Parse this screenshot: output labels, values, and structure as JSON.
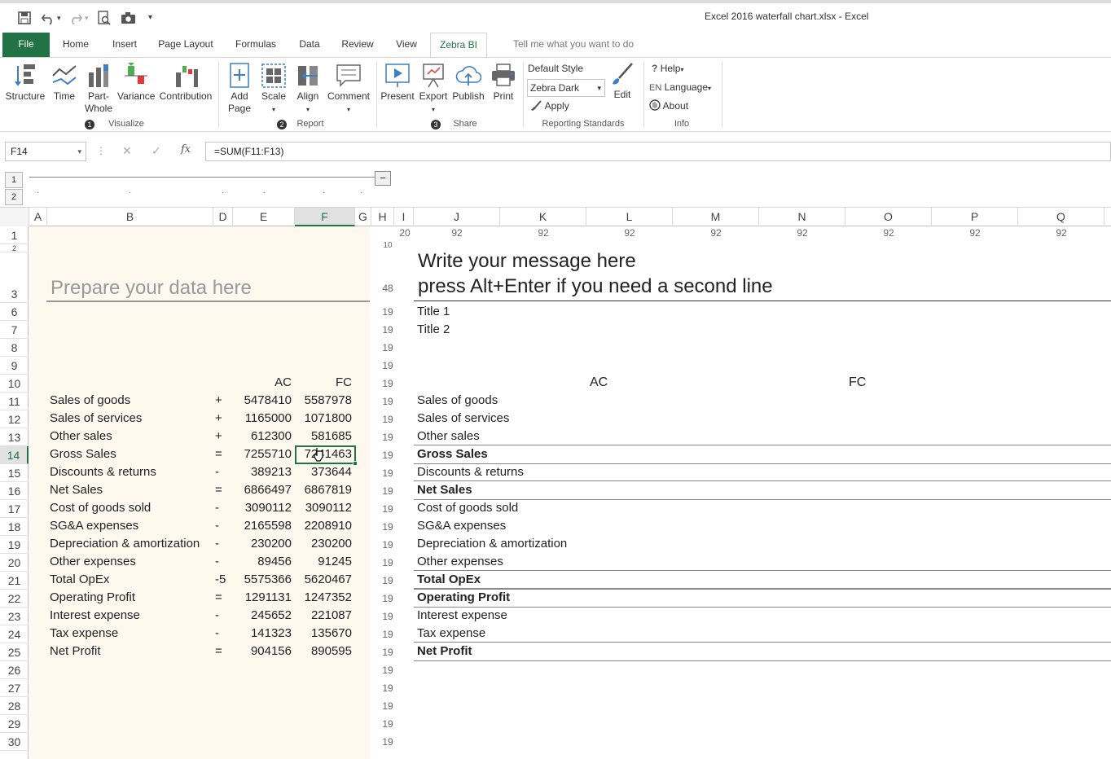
{
  "window": {
    "title": "Excel 2016 waterfall chart.xlsx - Excel"
  },
  "qat": {
    "save_icon": "save-icon",
    "undo_icon": "undo-icon",
    "redo_icon": "redo-icon",
    "preview_icon": "print-preview-icon",
    "camera_icon": "camera-icon"
  },
  "tabs": [
    "File",
    "Home",
    "Insert",
    "Page Layout",
    "Formulas",
    "Data",
    "Review",
    "View",
    "Zebra BI"
  ],
  "tell_me": "Tell me what you want to do",
  "ribbon": {
    "visualize": {
      "structure": "Structure",
      "time": "Time",
      "part_whole": "Part-\nWhole",
      "part": "Part-",
      "whole": "Whole",
      "variance": "Variance",
      "contribution": "Contribution",
      "label": "Visualize",
      "num": "1"
    },
    "report": {
      "add": "Add",
      "page": "Page",
      "scale": "Scale",
      "align": "Align",
      "comment": "Comment",
      "label": "Report",
      "num": "2"
    },
    "share": {
      "present": "Present",
      "export": "Export",
      "publish": "Publish",
      "print": "Print",
      "label": "Share",
      "num": "3"
    },
    "standards": {
      "default_style": "Default Style",
      "style_value": "Zebra Dark",
      "apply": "Apply",
      "edit": "Edit",
      "label": "Reporting Standards"
    },
    "info": {
      "help": "Help",
      "lang_code": "EN",
      "language": "Language",
      "about": "About",
      "label": "Info"
    }
  },
  "formula_bar": {
    "name_box": "F14",
    "fx": "fx",
    "formula": "=SUM(F11:F13)"
  },
  "outline": {
    "level1": "1",
    "level2": "2",
    "collapse": "−"
  },
  "columns": [
    "A",
    "B",
    "D",
    "E",
    "F",
    "G",
    "H",
    "I",
    "J",
    "K",
    "L",
    "M",
    "N",
    "O",
    "P",
    "Q"
  ],
  "col_widths": {
    "i": "20",
    "j": "92",
    "k": "92",
    "l": "92",
    "m": "92",
    "n": "92",
    "o": "92",
    "p": "92",
    "q": "92"
  },
  "rows": [
    "1",
    "2",
    "3",
    "6",
    "7",
    "8",
    "9",
    "10",
    "11",
    "12",
    "13",
    "14",
    "15",
    "16",
    "17",
    "18",
    "19",
    "20",
    "21",
    "22",
    "23",
    "24",
    "25",
    "26",
    "27",
    "28",
    "29",
    "30"
  ],
  "row_height_labels": {
    "r1": "10",
    "r3": "48",
    "std": "19"
  },
  "left": {
    "heading": "Prepare your data here",
    "col_ac": "AC",
    "col_fc": "FC",
    "items": [
      {
        "label": "Sales of goods",
        "op": "+",
        "ac": "5478410",
        "fc": "5587978"
      },
      {
        "label": "Sales of services",
        "op": "+",
        "ac": "1165000",
        "fc": "1071800"
      },
      {
        "label": "Other sales",
        "op": "+",
        "ac": "612300",
        "fc": "581685"
      },
      {
        "label": "Gross Sales",
        "op": "=",
        "ac": "7255710",
        "fc": "7241463"
      },
      {
        "label": "Discounts & returns",
        "op": "-",
        "ac": "389213",
        "fc": "373644"
      },
      {
        "label": "Net Sales",
        "op": "=",
        "ac": "6866497",
        "fc": "6867819"
      },
      {
        "label": "Cost of goods sold",
        "op": "-",
        "ac": "3090112",
        "fc": "3090112"
      },
      {
        "label": "SG&A expenses",
        "op": "-",
        "ac": "2165598",
        "fc": "2208910"
      },
      {
        "label": "Depreciation & amortization",
        "op": "-",
        "ac": "230200",
        "fc": "230200"
      },
      {
        "label": "Other expenses",
        "op": "-",
        "ac": "89456",
        "fc": "91245"
      },
      {
        "label": "Total OpEx",
        "op": "-5",
        "ac": "5575366",
        "fc": "5620467"
      },
      {
        "label": "Operating Profit",
        "op": "=",
        "ac": "1291131",
        "fc": "1247352"
      },
      {
        "label": "Interest expense",
        "op": "-",
        "ac": "245652",
        "fc": "221087"
      },
      {
        "label": "Tax expense",
        "op": "-",
        "ac": "141323",
        "fc": "135670"
      },
      {
        "label": "Net Profit",
        "op": "=",
        "ac": "904156",
        "fc": "890595"
      }
    ]
  },
  "right": {
    "message1": "Write your message here",
    "message2": "press Alt+Enter if you need a second line",
    "title1": "Title 1",
    "title2": "Title 2",
    "col_ac": "AC",
    "col_fc": "FC",
    "items": [
      {
        "label": "Sales of goods",
        "bold": false
      },
      {
        "label": "Sales of services",
        "bold": false
      },
      {
        "label": "Other sales",
        "bold": false
      },
      {
        "label": "Gross Sales",
        "bold": true
      },
      {
        "label": "Discounts & returns",
        "bold": false
      },
      {
        "label": "Net Sales",
        "bold": true
      },
      {
        "label": "Cost of goods sold",
        "bold": false
      },
      {
        "label": "SG&A expenses",
        "bold": false
      },
      {
        "label": "Depreciation & amortization",
        "bold": false
      },
      {
        "label": "Other expenses",
        "bold": false
      },
      {
        "label": "Total OpEx",
        "bold": true
      },
      {
        "label": "Operating Profit",
        "bold": true
      },
      {
        "label": "Interest expense",
        "bold": false
      },
      {
        "label": "Tax expense",
        "bold": false
      },
      {
        "label": "Net Profit",
        "bold": true
      }
    ]
  }
}
